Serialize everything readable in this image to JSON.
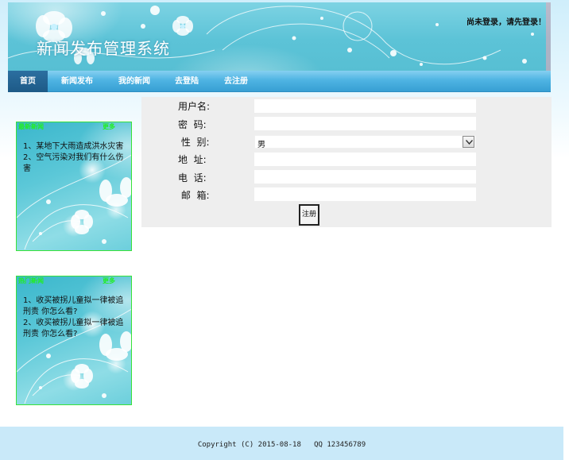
{
  "header": {
    "site_title": "新闻发布管理系统",
    "login_status": "尚未登录，请先登录！"
  },
  "nav": {
    "items": [
      {
        "label": "首页",
        "active": true
      },
      {
        "label": "新闻发布",
        "active": false
      },
      {
        "label": "我的新闻",
        "active": false
      },
      {
        "label": "去登陆",
        "active": false
      },
      {
        "label": "去注册",
        "active": false
      }
    ]
  },
  "sidebar": {
    "boxes": [
      {
        "title": "最新新闻",
        "more": "更多",
        "items": [
          "1、某地下大雨造成洪水灾害",
          "2、空气污染对我们有什么伤害"
        ]
      },
      {
        "title": "热门新闻",
        "more": "更多",
        "items": [
          "1、收买被拐儿童拟一律被追刑责 你怎么看?",
          "2、收买被拐儿童拟一律被追刑责 你怎么看?"
        ]
      }
    ]
  },
  "register_form": {
    "fields": [
      {
        "label": "用户名:",
        "type": "text",
        "value": ""
      },
      {
        "label": "密  码:",
        "type": "password",
        "value": ""
      },
      {
        "label": " 性  别:",
        "type": "select",
        "value": "男"
      },
      {
        "label": "地  址:",
        "type": "text",
        "value": ""
      },
      {
        "label": "电  话:",
        "type": "text",
        "value": ""
      },
      {
        "label": " 邮  箱:",
        "type": "text",
        "value": ""
      }
    ],
    "submit_label": "注册"
  },
  "footer": {
    "text": "Copyright (C) 2015-08-18   QQ 123456789"
  },
  "colors": {
    "nav_active": "#1d5a87",
    "nav_bar": "#4fb4e3",
    "side_border": "#39e239",
    "side_heading": "#22ee22",
    "form_bg": "#eeeeee",
    "footer_bg": "#c9e9f9"
  }
}
